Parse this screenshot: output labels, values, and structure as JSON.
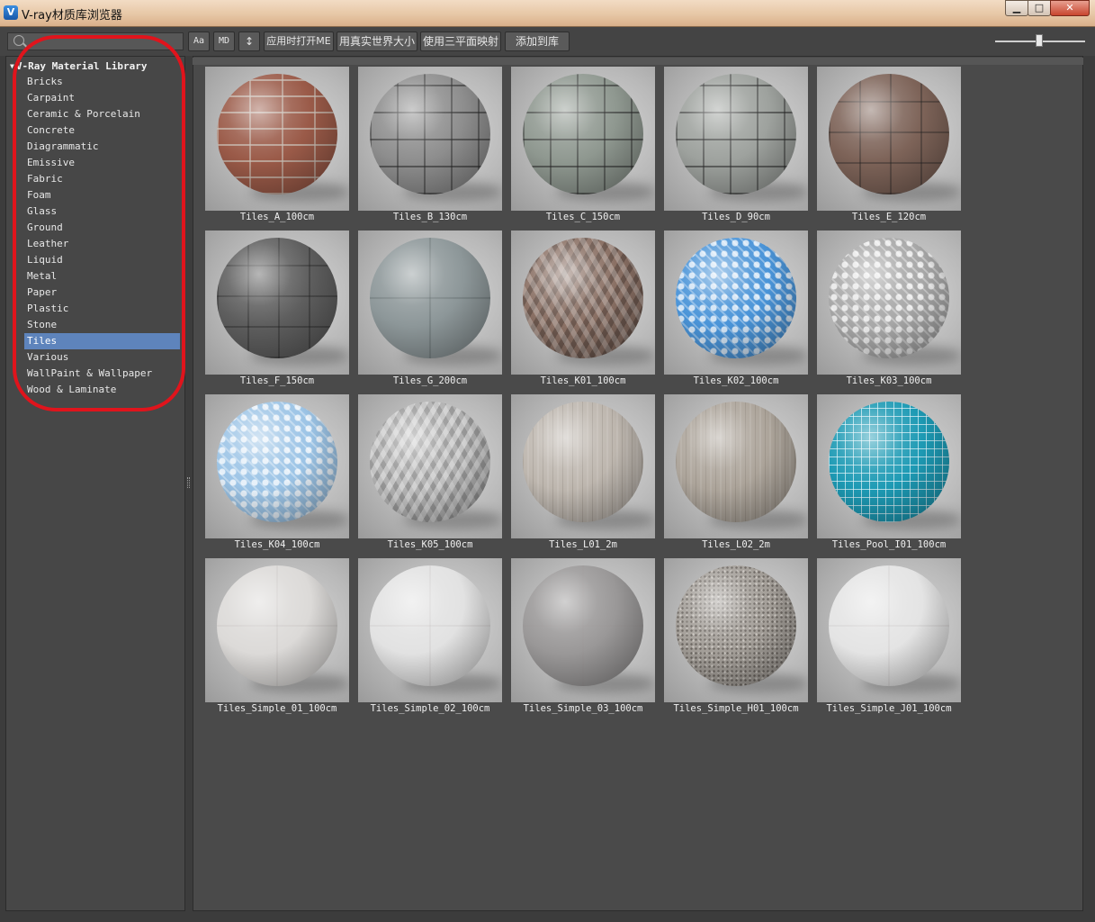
{
  "window": {
    "title": "V-ray材质库浏览器",
    "icon": "V",
    "buttons": [
      "▁",
      "□",
      "✕"
    ]
  },
  "toolbar": {
    "search_placeholder": "",
    "btn_case": "Aa",
    "btn_md": "MD",
    "btn_sort": "↕",
    "btn_apply_me": "应用时打开ME",
    "btn_real_world": "用真实世界大小",
    "btn_triplanar": "使用三平面映射",
    "btn_add_library": "添加到库"
  },
  "tree": {
    "root": "V-Ray Material Library",
    "items": [
      "Bricks",
      "Carpaint",
      "Ceramic & Porcelain",
      "Concrete",
      "Diagrammatic",
      "Emissive",
      "Fabric",
      "Foam",
      "Glass",
      "Ground",
      "Leather",
      "Liquid",
      "Metal",
      "Paper",
      "Plastic",
      "Stone",
      "Tiles",
      "Various",
      "WallPaint & Wallpaper",
      "Wood & Laminate"
    ],
    "selected": "Tiles"
  },
  "materials": [
    {
      "name": "Tiles_A_100cm",
      "color": "#9a5a48",
      "pattern": "brick"
    },
    {
      "name": "Tiles_B_130cm",
      "color": "#8e8e8e",
      "pattern": "paver"
    },
    {
      "name": "Tiles_C_150cm",
      "color": "#8f9890",
      "pattern": "paver"
    },
    {
      "name": "Tiles_D_90cm",
      "color": "#9ea29e",
      "pattern": "paver"
    },
    {
      "name": "Tiles_E_120cm",
      "color": "#7d6358",
      "pattern": "square"
    },
    {
      "name": "Tiles_F_150cm",
      "color": "#5e5e5e",
      "pattern": "square"
    },
    {
      "name": "Tiles_G_200cm",
      "color": "#8d9799",
      "pattern": "plain"
    },
    {
      "name": "Tiles_K01_100cm",
      "color": "#8a7064",
      "pattern": "cube"
    },
    {
      "name": "Tiles_K02_100cm",
      "color": "#4a94d8",
      "pattern": "ornate"
    },
    {
      "name": "Tiles_K03_100cm",
      "color": "#a8a8a8",
      "pattern": "ornate"
    },
    {
      "name": "Tiles_K04_100cm",
      "color": "#9cc4e6",
      "pattern": "ornate"
    },
    {
      "name": "Tiles_K05_100cm",
      "color": "#c2c2c2",
      "pattern": "cube"
    },
    {
      "name": "Tiles_L01_2m",
      "color": "#bdb6ae",
      "pattern": "wood"
    },
    {
      "name": "Tiles_L02_2m",
      "color": "#aca49a",
      "pattern": "wood"
    },
    {
      "name": "Tiles_Pool_I01_100cm",
      "color": "#1d9ab4",
      "pattern": "grid"
    },
    {
      "name": "Tiles_Simple_01_100cm",
      "color": "#dcdad8",
      "pattern": "gloss"
    },
    {
      "name": "Tiles_Simple_02_100cm",
      "color": "#e2e2e2",
      "pattern": "gloss"
    },
    {
      "name": "Tiles_Simple_03_100cm",
      "color": "#9a9898",
      "pattern": "gloss"
    },
    {
      "name": "Tiles_Simple_H01_100cm",
      "color": "#a39e98",
      "pattern": "speckle"
    },
    {
      "name": "Tiles_Simple_J01_100cm",
      "color": "#e4e4e4",
      "pattern": "gloss"
    }
  ]
}
